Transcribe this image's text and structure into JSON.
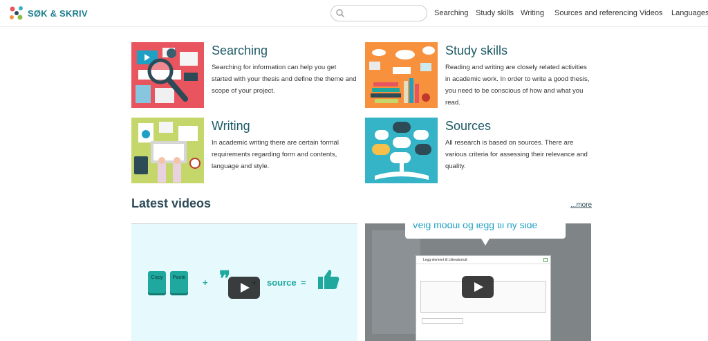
{
  "header": {
    "logo_text": "SØK & SKRIV",
    "search": {
      "placeholder": "",
      "value": ""
    },
    "nav": [
      "Searching",
      "Study skills",
      "Writing",
      "Sources and referencing",
      "Videos",
      "Languages"
    ]
  },
  "cards": [
    {
      "title": "Searching",
      "text": "Searching for information can help you get started with your thesis and define the theme and scope of your project.",
      "bg": "#e8555f"
    },
    {
      "title": "Study skills",
      "text": "Reading and writing are closely related activities in academic work. In order to write a good thesis, you need to be conscious of how and what you read.",
      "bg": "#f7913d"
    },
    {
      "title": "Writing",
      "text": "In academic writing there are certain formal requirements regarding form and contents, language and style.",
      "bg": "#c5d66a"
    },
    {
      "title": "Sources",
      "text": "All research is based on sources. There are various criteria for assessing their relevance and quality.",
      "bg": "#35b3c7"
    }
  ],
  "videos_section": {
    "heading": "Latest videos",
    "more_link": "...more",
    "video1": {
      "key1": "Copy",
      "key2": "Paste",
      "plus1": "+",
      "plus2": "+",
      "source_word": "source",
      "equals": "=",
      "bg": "#e6f9fc"
    },
    "video2": {
      "banner": "Velg modul og legg til ny side",
      "dialog_title": "Legg element til Litteraturrutt",
      "bg": "#7f8487"
    }
  },
  "colors": {
    "accent": "#1f7f8f",
    "heading": "#1d5a66"
  }
}
